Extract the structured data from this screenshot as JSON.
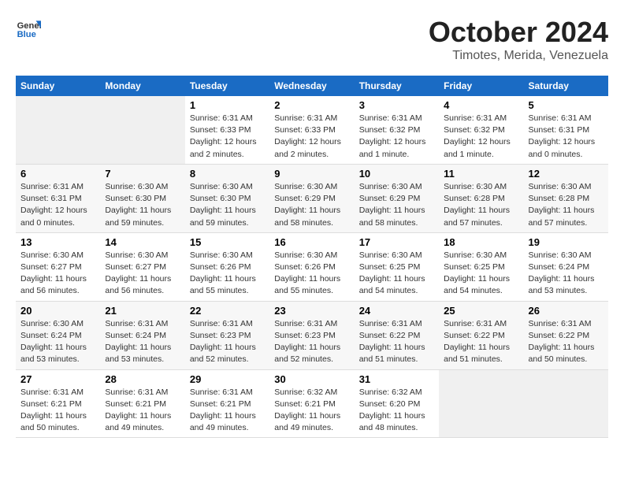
{
  "logo": {
    "line1": "General",
    "line2": "Blue"
  },
  "title": "October 2024",
  "subtitle": "Timotes, Merida, Venezuela",
  "days_header": [
    "Sunday",
    "Monday",
    "Tuesday",
    "Wednesday",
    "Thursday",
    "Friday",
    "Saturday"
  ],
  "weeks": [
    [
      {
        "day": "",
        "info": ""
      },
      {
        "day": "",
        "info": ""
      },
      {
        "day": "1",
        "sunrise": "6:31 AM",
        "sunset": "6:33 PM",
        "daylight": "12 hours and 2 minutes."
      },
      {
        "day": "2",
        "sunrise": "6:31 AM",
        "sunset": "6:33 PM",
        "daylight": "12 hours and 2 minutes."
      },
      {
        "day": "3",
        "sunrise": "6:31 AM",
        "sunset": "6:32 PM",
        "daylight": "12 hours and 1 minute."
      },
      {
        "day": "4",
        "sunrise": "6:31 AM",
        "sunset": "6:32 PM",
        "daylight": "12 hours and 1 minute."
      },
      {
        "day": "5",
        "sunrise": "6:31 AM",
        "sunset": "6:31 PM",
        "daylight": "12 hours and 0 minutes."
      }
    ],
    [
      {
        "day": "6",
        "sunrise": "6:31 AM",
        "sunset": "6:31 PM",
        "daylight": "12 hours and 0 minutes."
      },
      {
        "day": "7",
        "sunrise": "6:30 AM",
        "sunset": "6:30 PM",
        "daylight": "11 hours and 59 minutes."
      },
      {
        "day": "8",
        "sunrise": "6:30 AM",
        "sunset": "6:30 PM",
        "daylight": "11 hours and 59 minutes."
      },
      {
        "day": "9",
        "sunrise": "6:30 AM",
        "sunset": "6:29 PM",
        "daylight": "11 hours and 58 minutes."
      },
      {
        "day": "10",
        "sunrise": "6:30 AM",
        "sunset": "6:29 PM",
        "daylight": "11 hours and 58 minutes."
      },
      {
        "day": "11",
        "sunrise": "6:30 AM",
        "sunset": "6:28 PM",
        "daylight": "11 hours and 57 minutes."
      },
      {
        "day": "12",
        "sunrise": "6:30 AM",
        "sunset": "6:28 PM",
        "daylight": "11 hours and 57 minutes."
      }
    ],
    [
      {
        "day": "13",
        "sunrise": "6:30 AM",
        "sunset": "6:27 PM",
        "daylight": "11 hours and 56 minutes."
      },
      {
        "day": "14",
        "sunrise": "6:30 AM",
        "sunset": "6:27 PM",
        "daylight": "11 hours and 56 minutes."
      },
      {
        "day": "15",
        "sunrise": "6:30 AM",
        "sunset": "6:26 PM",
        "daylight": "11 hours and 55 minutes."
      },
      {
        "day": "16",
        "sunrise": "6:30 AM",
        "sunset": "6:26 PM",
        "daylight": "11 hours and 55 minutes."
      },
      {
        "day": "17",
        "sunrise": "6:30 AM",
        "sunset": "6:25 PM",
        "daylight": "11 hours and 54 minutes."
      },
      {
        "day": "18",
        "sunrise": "6:30 AM",
        "sunset": "6:25 PM",
        "daylight": "11 hours and 54 minutes."
      },
      {
        "day": "19",
        "sunrise": "6:30 AM",
        "sunset": "6:24 PM",
        "daylight": "11 hours and 53 minutes."
      }
    ],
    [
      {
        "day": "20",
        "sunrise": "6:30 AM",
        "sunset": "6:24 PM",
        "daylight": "11 hours and 53 minutes."
      },
      {
        "day": "21",
        "sunrise": "6:31 AM",
        "sunset": "6:24 PM",
        "daylight": "11 hours and 53 minutes."
      },
      {
        "day": "22",
        "sunrise": "6:31 AM",
        "sunset": "6:23 PM",
        "daylight": "11 hours and 52 minutes."
      },
      {
        "day": "23",
        "sunrise": "6:31 AM",
        "sunset": "6:23 PM",
        "daylight": "11 hours and 52 minutes."
      },
      {
        "day": "24",
        "sunrise": "6:31 AM",
        "sunset": "6:22 PM",
        "daylight": "11 hours and 51 minutes."
      },
      {
        "day": "25",
        "sunrise": "6:31 AM",
        "sunset": "6:22 PM",
        "daylight": "11 hours and 51 minutes."
      },
      {
        "day": "26",
        "sunrise": "6:31 AM",
        "sunset": "6:22 PM",
        "daylight": "11 hours and 50 minutes."
      }
    ],
    [
      {
        "day": "27",
        "sunrise": "6:31 AM",
        "sunset": "6:21 PM",
        "daylight": "11 hours and 50 minutes."
      },
      {
        "day": "28",
        "sunrise": "6:31 AM",
        "sunset": "6:21 PM",
        "daylight": "11 hours and 49 minutes."
      },
      {
        "day": "29",
        "sunrise": "6:31 AM",
        "sunset": "6:21 PM",
        "daylight": "11 hours and 49 minutes."
      },
      {
        "day": "30",
        "sunrise": "6:32 AM",
        "sunset": "6:21 PM",
        "daylight": "11 hours and 49 minutes."
      },
      {
        "day": "31",
        "sunrise": "6:32 AM",
        "sunset": "6:20 PM",
        "daylight": "11 hours and 48 minutes."
      },
      {
        "day": "",
        "info": ""
      },
      {
        "day": "",
        "info": ""
      }
    ]
  ]
}
